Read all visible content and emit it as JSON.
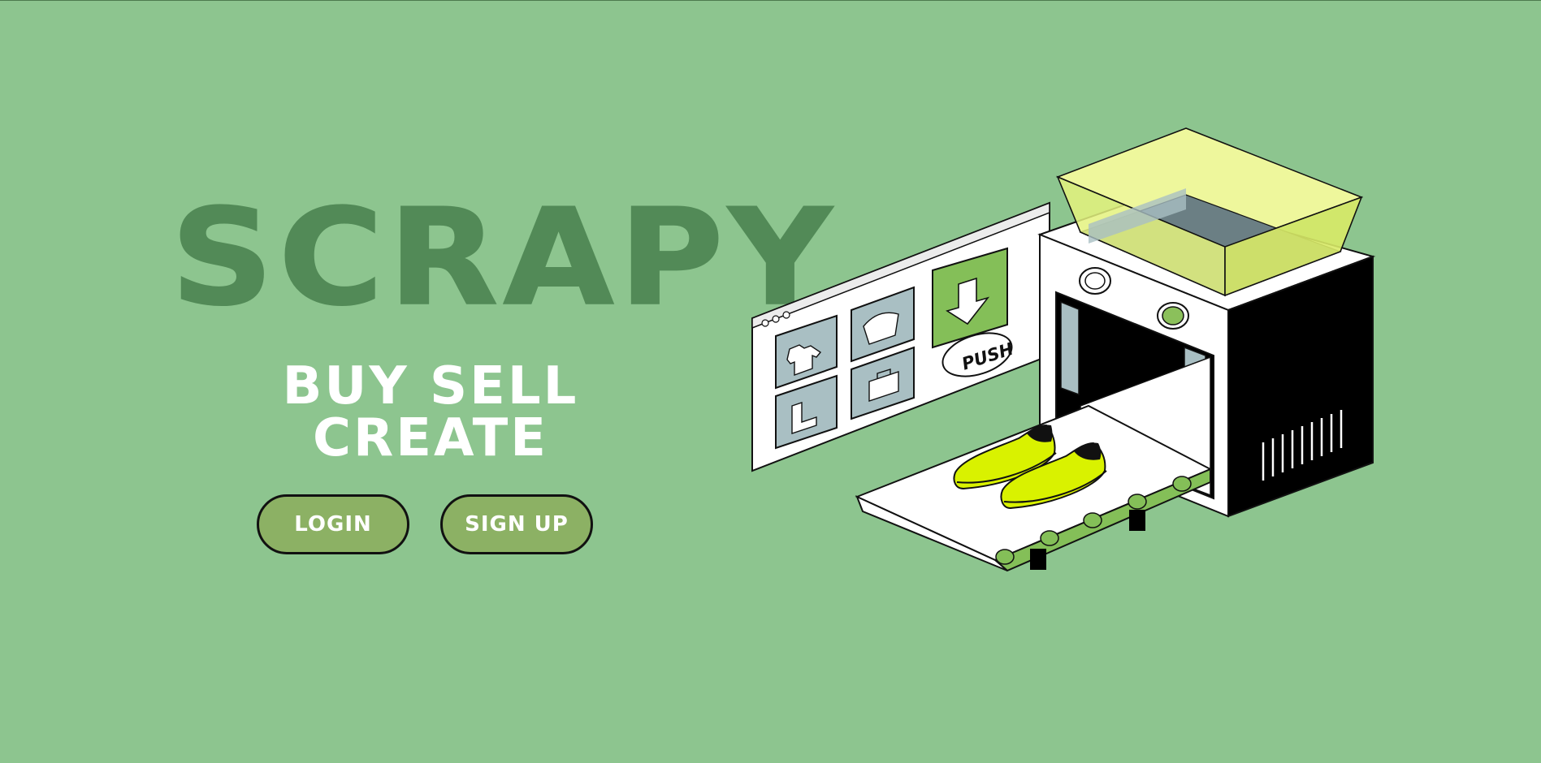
{
  "brand": {
    "name": "SCRAPY",
    "tagline": "BUY SELL CREATE"
  },
  "actions": {
    "login_label": "LOGIN",
    "signup_label": "SIGN UP"
  },
  "illustration": {
    "push_label": "PUSH",
    "subject": "machine-with-conveyor-and-sneakers"
  },
  "colors": {
    "background": "#8dc58f",
    "brand_text": "#528a57",
    "button_fill": "#8cb164",
    "sneaker": "#d9f200"
  }
}
